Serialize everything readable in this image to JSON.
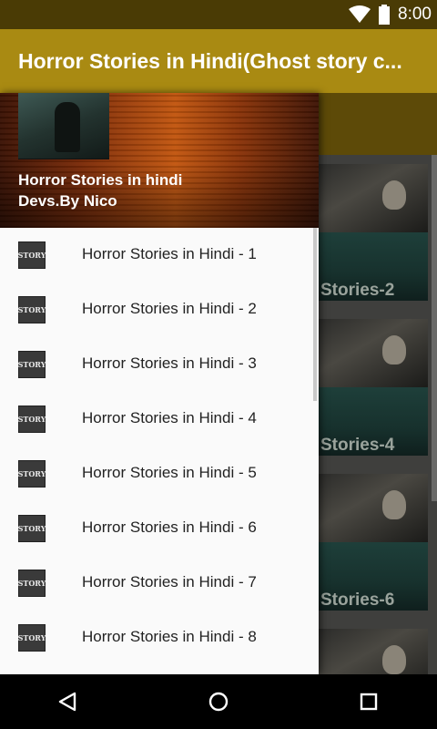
{
  "status_bar": {
    "time": "8:00",
    "icons": [
      "wifi-icon",
      "battery-icon"
    ]
  },
  "app_bar": {
    "title": "Horror Stories in Hindi(Ghost story c..."
  },
  "drawer": {
    "header": {
      "name": "Horror Stories in hindi",
      "subtitle": "Devs.By Nico"
    },
    "icon_text": "STORY",
    "items": [
      {
        "label": "Horror Stories in Hindi - 1"
      },
      {
        "label": "Horror Stories in Hindi - 2"
      },
      {
        "label": "Horror Stories in Hindi - 3"
      },
      {
        "label": "Horror Stories in Hindi - 4"
      },
      {
        "label": "Horror Stories in Hindi - 5"
      },
      {
        "label": "Horror Stories in Hindi - 6"
      },
      {
        "label": "Horror Stories in Hindi - 7"
      },
      {
        "label": "Horror Stories in Hindi - 8"
      }
    ]
  },
  "content": {
    "cards": [
      {
        "label": "Stories-2"
      },
      {
        "label": "Stories-4"
      },
      {
        "label": "Stories-6"
      },
      {
        "label": ""
      }
    ]
  },
  "nav_bar": {
    "buttons": [
      "back-icon",
      "home-icon",
      "recents-icon"
    ]
  },
  "colors": {
    "status_bar": "#4a3b05",
    "app_bar": "#a98a12",
    "drawer_bg": "#fafafa",
    "nav_bar": "#000000"
  }
}
